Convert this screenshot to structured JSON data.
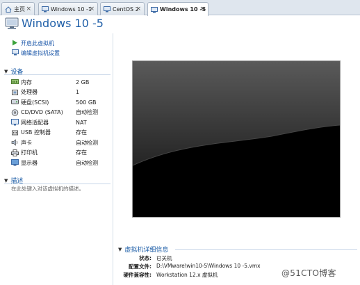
{
  "tabs": [
    {
      "label": "主页",
      "icon": "home-icon"
    },
    {
      "label": "Windows 10 -1",
      "icon": "vm-icon"
    },
    {
      "label": "CentOS 2",
      "icon": "vm-icon"
    },
    {
      "label": "Windows 10 -5",
      "icon": "vm-icon",
      "active": true
    }
  ],
  "tab_close_glyph": "×",
  "vm": {
    "title": "Windows 10 -5"
  },
  "actions": [
    {
      "label": "开启此虚拟机",
      "icon": "play-icon"
    },
    {
      "label": "编辑虚拟机设置",
      "icon": "edit-settings-icon"
    }
  ],
  "devices_section": {
    "title": "设备"
  },
  "devices": [
    {
      "name": "内存",
      "value": "2 GB",
      "icon": "memory-icon"
    },
    {
      "name": "处理器",
      "value": "1",
      "icon": "cpu-icon"
    },
    {
      "name": "硬盘(SCSI)",
      "value": "500 GB",
      "icon": "harddisk-icon"
    },
    {
      "name": "CD/DVD (SATA)",
      "value": "自动检测",
      "icon": "cd-dvd-icon"
    },
    {
      "name": "网络适配器",
      "value": "NAT",
      "icon": "network-adapter-icon"
    },
    {
      "name": "USB 控制器",
      "value": "存在",
      "icon": "usb-icon"
    },
    {
      "name": "声卡",
      "value": "自动检测",
      "icon": "sound-card-icon"
    },
    {
      "name": "打印机",
      "value": "存在",
      "icon": "printer-icon"
    },
    {
      "name": "显示器",
      "value": "自动检测",
      "icon": "monitor-icon"
    }
  ],
  "description_section": {
    "title": "描述",
    "placeholder": "在此处键入对该虚拟机的描述。"
  },
  "details": {
    "title": "虚拟机详细信息",
    "rows": [
      {
        "key": "状态:",
        "value": "已关机"
      },
      {
        "key": "配置文件:",
        "value": "D:\\VMware\\win10-5\\Windows 10 -5.vmx"
      },
      {
        "key": "硬件兼容性:",
        "value": "Workstation 12.x 虚拟机"
      }
    ]
  },
  "watermark": "@51CTO博客",
  "colors": {
    "accent": "#1f5fa8",
    "play": "#3aa23a"
  }
}
